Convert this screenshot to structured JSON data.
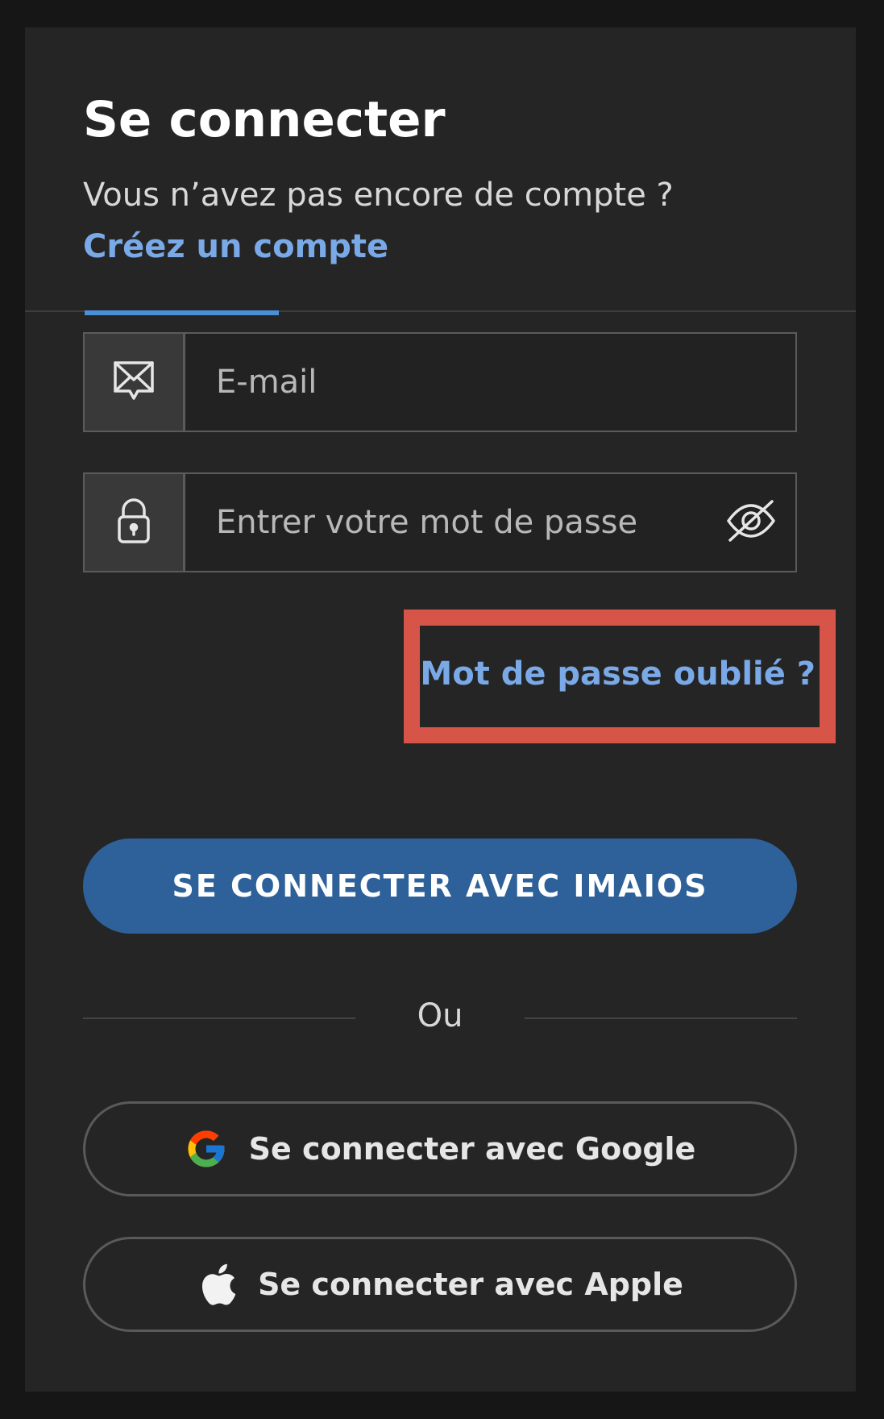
{
  "header": {
    "title": "Se connecter",
    "subtitle_prefix": "Vous n’avez pas encore de compte ? ",
    "create_account_link": "Créez un compte"
  },
  "form": {
    "email": {
      "placeholder": "E-mail",
      "value": "",
      "icon": "envelope-icon"
    },
    "password": {
      "placeholder": "Entrer votre mot de passe",
      "value": "",
      "icon": "lock-icon",
      "toggle_icon": "eye-slash-icon"
    },
    "forgot_password_link": "Mot de passe oublié ?",
    "submit_label": "SE CONNECTER AVEC IMAIOS"
  },
  "divider": {
    "label": "Ou"
  },
  "social": {
    "google_label": "Se connecter avec Google",
    "apple_label": "Se connecter avec Apple",
    "google_icon": "google-logo-icon",
    "apple_icon": "apple-logo-icon"
  },
  "colors": {
    "background": "#161616",
    "panel": "#252525",
    "link": "#7aa9e8",
    "primary_button": "#2e6199",
    "highlight_box": "#d65548",
    "required_dot": "#e8332c"
  }
}
